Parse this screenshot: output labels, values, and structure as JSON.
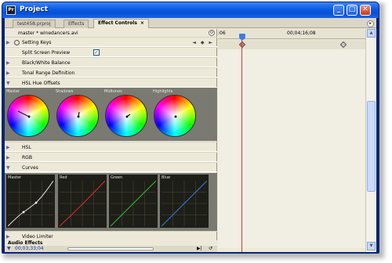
{
  "window": {
    "title": "Project"
  },
  "title_buttons": {
    "minimize": "_",
    "maximize": "□",
    "close": "✕"
  },
  "tabs": [
    {
      "label": "test458.prproj",
      "active": false
    },
    {
      "label": "Effects",
      "active": false
    },
    {
      "label": "Effect Controls",
      "active": true,
      "close": "×"
    }
  ],
  "source": {
    "label": "master * winedancers.avi"
  },
  "effects": {
    "setting_keys": "Setting Keys",
    "split_preview": "Split Screen Preview",
    "split_checked": "✓",
    "bw": "Black/White Balance",
    "tonal": "Tonal Range Definition",
    "hsl_offsets": "HSL Hue Offsets",
    "hsl": "HSL",
    "rgb": "RGB",
    "curves": "Curves",
    "video_limiter": "Video Limiter",
    "audio_effects": "Audio Effects"
  },
  "wheels": [
    "Master",
    "Shadows",
    "Midtones",
    "Highlights"
  ],
  "curves": [
    "Master",
    "Red",
    "Green",
    "Blue"
  ],
  "timecode": {
    "current": "00;03;33;04"
  },
  "ruler": {
    "start": ":06",
    "mark": "00;04;16;08"
  },
  "key_nav": "◄ ◆ ►",
  "colors": {
    "titlebar": "#0a5ae2",
    "accent": "#3a7de6",
    "playhead": "#e2352b"
  }
}
